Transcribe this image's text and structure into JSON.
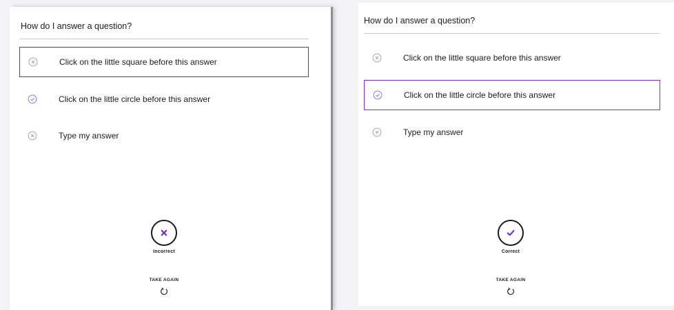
{
  "colors": {
    "accent": "#7b2fbe",
    "correct_icon": "#6f6fd8",
    "incorrect_icon": "#9a9a9a",
    "selected_border_left": "#4a4a4a",
    "text": "#1b1b1b"
  },
  "left": {
    "question": "How do I answer a question?",
    "options": [
      {
        "label": "Click on the little square before this answer",
        "icon": "x-circle-icon",
        "selected": true
      },
      {
        "label": "Click on the little circle before this answer",
        "icon": "check-circle-icon",
        "selected": false
      },
      {
        "label": "Type my answer",
        "icon": "x-circle-icon",
        "selected": false
      }
    ],
    "result": {
      "icon": "x-mark-icon",
      "label": "Incorrect"
    },
    "take_again": {
      "label": "TAKE AGAIN",
      "icon": "refresh-icon"
    }
  },
  "right": {
    "question": "How do I answer a question?",
    "options": [
      {
        "label": "Click on the little square before this answer",
        "icon": "x-circle-icon",
        "selected": false
      },
      {
        "label": "Click on the little circle before this answer",
        "icon": "check-circle-icon",
        "selected": true
      },
      {
        "label": "Type my answer",
        "icon": "x-circle-icon",
        "selected": false
      }
    ],
    "result": {
      "icon": "check-mark-icon",
      "label": "Correct"
    },
    "take_again": {
      "label": "TAKE AGAIN",
      "icon": "refresh-icon"
    }
  }
}
